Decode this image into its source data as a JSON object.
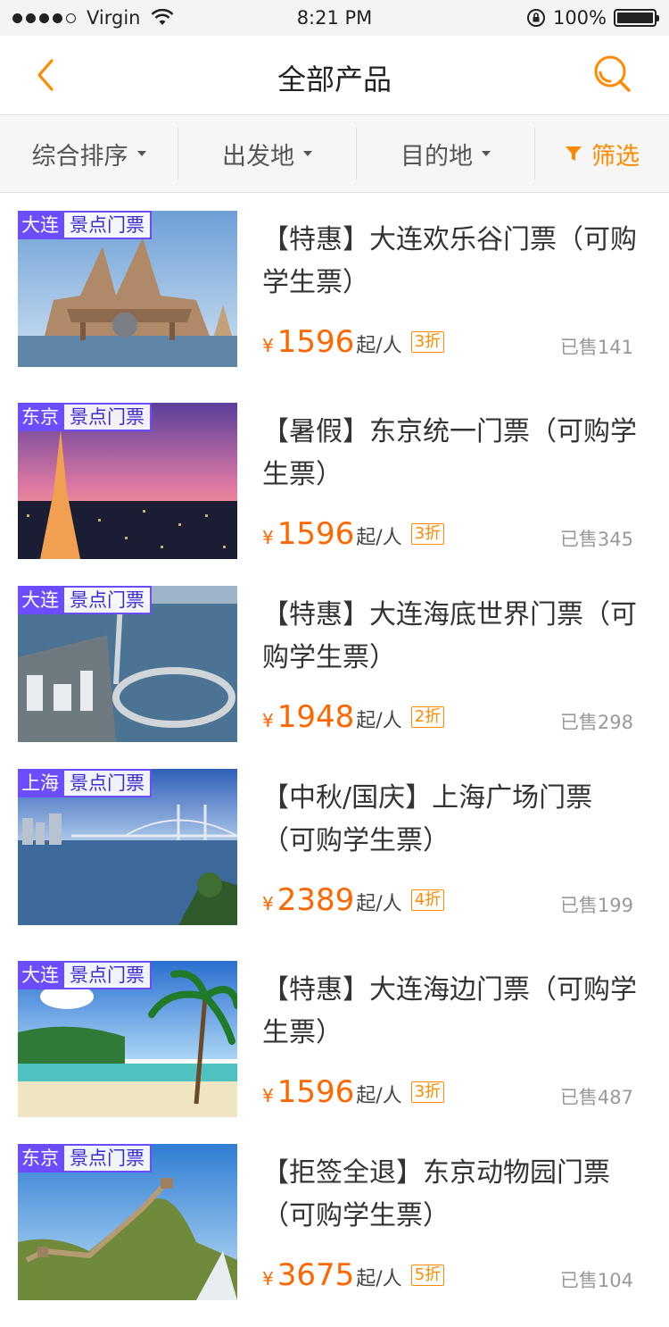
{
  "status_bar": {
    "carrier": "Virgin",
    "time": "8:21 PM",
    "battery": "100%",
    "battery_level": 1.0
  },
  "nav": {
    "title": "全部产品",
    "back_icon": "chevron-left-icon",
    "search_icon": "search-icon"
  },
  "filters": {
    "sort_label": "综合排序",
    "departure_label": "出发地",
    "destination_label": "目的地",
    "filter_label": "筛选"
  },
  "colors": {
    "accent": "#ff8a00",
    "price": "#ff6600",
    "tag_city_bg": "#6b4cff"
  },
  "products": [
    {
      "city": "大连",
      "type": "景点门票",
      "title": "【特惠】大连欢乐谷门票（可购学生票）",
      "yen": "¥",
      "price": "1596",
      "unit": "起/人",
      "discount": "3折",
      "sold": "已售141",
      "image": "castle"
    },
    {
      "city": "东京",
      "type": "景点门票",
      "title": "【暑假】东京统一门票（可购学生票）",
      "yen": "¥",
      "price": "1596",
      "unit": "起/人",
      "discount": "3折",
      "sold": "已售345",
      "image": "tower"
    },
    {
      "city": "大连",
      "type": "景点门票",
      "title": "【特惠】大连海底世界门票（可购学生票）",
      "yen": "¥",
      "price": "1948",
      "unit": "起/人",
      "discount": "2折",
      "sold": "已售298",
      "image": "bridge-loop"
    },
    {
      "city": "上海",
      "type": "景点门票",
      "title": "【中秋/国庆】上海广场门票（可购学生票）",
      "yen": "¥",
      "price": "2389",
      "unit": "起/人",
      "discount": "4折",
      "sold": "已售199",
      "image": "harbor"
    },
    {
      "city": "大连",
      "type": "景点门票",
      "title": "【特惠】大连海边门票（可购学生票）",
      "yen": "¥",
      "price": "1596",
      "unit": "起/人",
      "discount": "3折",
      "sold": "已售487",
      "image": "beach"
    },
    {
      "city": "东京",
      "type": "景点门票",
      "title": "【拒签全退】东京动物园门票（可购学生票）",
      "yen": "¥",
      "price": "3675",
      "unit": "起/人",
      "discount": "5折",
      "sold": "已售104",
      "image": "great-wall"
    }
  ]
}
